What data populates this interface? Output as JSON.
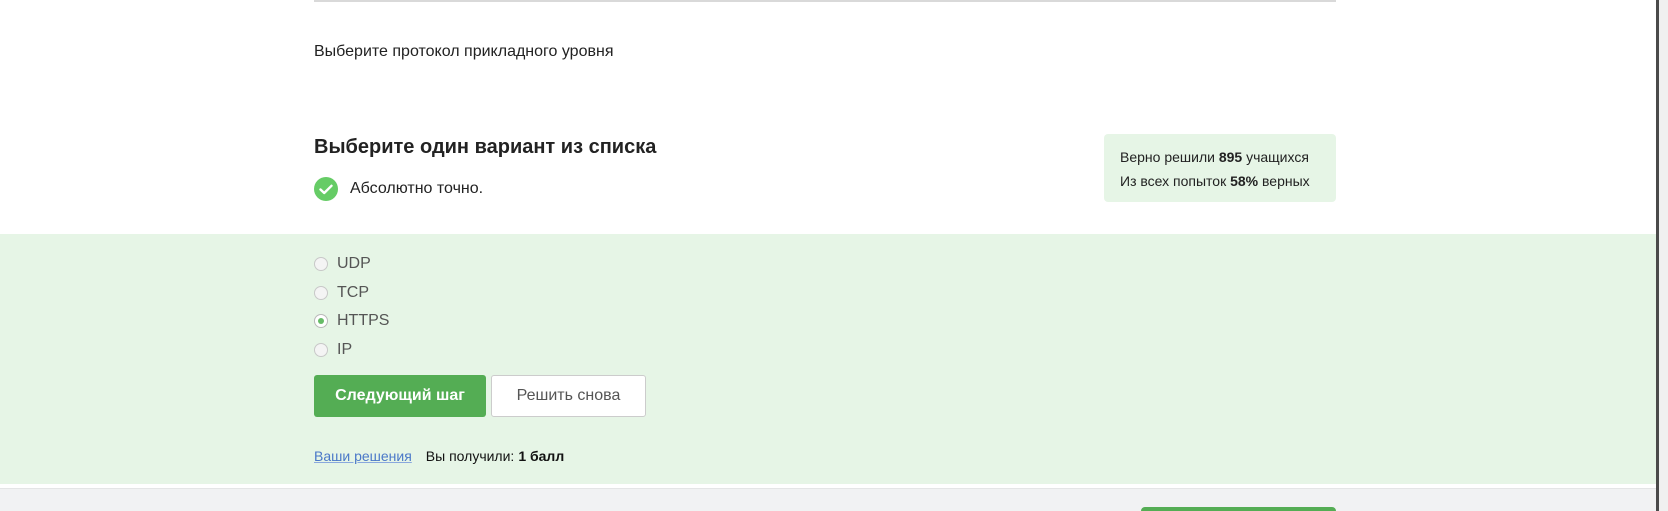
{
  "question": {
    "text": "Выберите протокол прикладного уровня"
  },
  "task": {
    "title": "Выберите один вариант из списка",
    "feedback": "Абсолютно точно."
  },
  "stats": {
    "solved_prefix": "Верно решили",
    "solved_count": "895",
    "solved_suffix": "учащихся",
    "attempts_prefix": "Из всех попыток",
    "attempts_percent": "58%",
    "attempts_suffix": "верных"
  },
  "options": [
    {
      "label": "UDP",
      "selected": false
    },
    {
      "label": "TCP",
      "selected": false
    },
    {
      "label": "HTTPS",
      "selected": true
    },
    {
      "label": "IP",
      "selected": false
    }
  ],
  "buttons": {
    "next": "Следующий шаг",
    "retry": "Решить снова"
  },
  "result": {
    "solutions_link": "Ваши решения",
    "score_label": "Вы получили:",
    "score_value": "1 балл"
  },
  "colors": {
    "accent_green": "#54ad54",
    "check_green": "#66cc66",
    "answer_background": "#e6f5e6",
    "link_blue": "#4a78c8"
  },
  "icons": {
    "feedback": "check-circle-icon"
  }
}
